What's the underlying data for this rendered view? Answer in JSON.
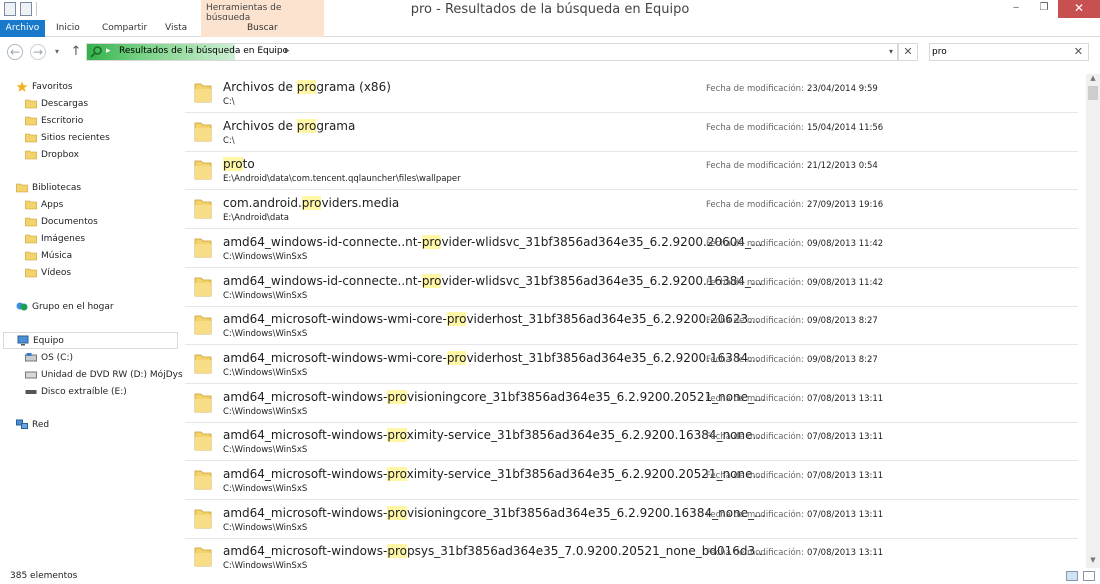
{
  "window": {
    "title": "pro - Resultados de la búsqueda en Equipo",
    "context_tab": "Herramientas de búsqueda",
    "buttons": {
      "minimize": "‒",
      "maximize": "❐",
      "close": "✕"
    }
  },
  "ribbon": {
    "tabs": [
      "Archivo",
      "Inicio",
      "Compartir",
      "Vista",
      "Buscar"
    ]
  },
  "address": {
    "breadcrumb": "Resultados de la búsqueda en Equipo",
    "search_value": "pro"
  },
  "nav": {
    "groups": [
      {
        "label": "Favoritos",
        "icon": "star-icon",
        "items": [
          {
            "label": "Descargas",
            "icon": "downloads-icon"
          },
          {
            "label": "Escritorio",
            "icon": "desktop-icon"
          },
          {
            "label": "Sitios recientes",
            "icon": "recent-places-icon"
          },
          {
            "label": "Dropbox",
            "icon": "dropbox-icon"
          }
        ]
      },
      {
        "label": "Bibliotecas",
        "icon": "libraries-icon",
        "items": [
          {
            "label": "Apps",
            "icon": "folder-icon"
          },
          {
            "label": "Documentos",
            "icon": "documents-icon"
          },
          {
            "label": "Imágenes",
            "icon": "pictures-icon"
          },
          {
            "label": "Música",
            "icon": "music-icon"
          },
          {
            "label": "Vídeos",
            "icon": "videos-icon"
          }
        ]
      },
      {
        "label": "Grupo en el hogar",
        "icon": "homegroup-icon",
        "items": []
      },
      {
        "label": "Equipo",
        "icon": "computer-icon",
        "selected": true,
        "items": [
          {
            "label": "OS (C:)",
            "icon": "drive-icon"
          },
          {
            "label": "Unidad de DVD RW (D:) MójDys",
            "icon": "dvd-drive-icon"
          },
          {
            "label": "Disco extraíble (E:)",
            "icon": "removable-drive-icon"
          }
        ]
      },
      {
        "label": "Red",
        "icon": "network-icon",
        "items": []
      }
    ]
  },
  "results": {
    "modified_label": "Fecha de modificación:",
    "items": [
      {
        "pre": "Archivos de ",
        "match": "pro",
        "post": "grama (x86)",
        "path": "C:\\",
        "date": "23/04/2014 9:59"
      },
      {
        "pre": "Archivos de ",
        "match": "pro",
        "post": "grama",
        "path": "C:\\",
        "date": "15/04/2014 11:56"
      },
      {
        "pre": "",
        "match": "pro",
        "post": "to",
        "path": "E:\\Android\\data\\com.tencent.qqlauncher\\files\\wallpaper",
        "date": "21/12/2013 0:54"
      },
      {
        "pre": "com.android.",
        "match": "pro",
        "post": "viders.media",
        "path": "E:\\Android\\data",
        "date": "27/09/2013 19:16"
      },
      {
        "pre": "amd64_windows-id-connecte..nt-",
        "match": "pro",
        "post": "vider-wlidsvc_31bf3856ad364e35_6.2.9200.20604_...",
        "path": "C:\\Windows\\WinSxS",
        "date": "09/08/2013 11:42"
      },
      {
        "pre": "amd64_windows-id-connecte..nt-",
        "match": "pro",
        "post": "vider-wlidsvc_31bf3856ad364e35_6.2.9200.16384_...",
        "path": "C:\\Windows\\WinSxS",
        "date": "09/08/2013 11:42"
      },
      {
        "pre": "amd64_microsoft-windows-wmi-core-",
        "match": "pro",
        "post": "viderhost_31bf3856ad364e35_6.2.9200.20623...",
        "path": "C:\\Windows\\WinSxS",
        "date": "09/08/2013 8:27"
      },
      {
        "pre": "amd64_microsoft-windows-wmi-core-",
        "match": "pro",
        "post": "viderhost_31bf3856ad364e35_6.2.9200.16384...",
        "path": "C:\\Windows\\WinSxS",
        "date": "09/08/2013 8:27"
      },
      {
        "pre": "amd64_microsoft-windows-",
        "match": "pro",
        "post": "visioningcore_31bf3856ad364e35_6.2.9200.20521_none_...",
        "path": "C:\\Windows\\WinSxS",
        "date": "07/08/2013 13:11"
      },
      {
        "pre": "amd64_microsoft-windows-",
        "match": "pro",
        "post": "ximity-service_31bf3856ad364e35_6.2.9200.16384_none...",
        "path": "C:\\Windows\\WinSxS",
        "date": "07/08/2013 13:11"
      },
      {
        "pre": "amd64_microsoft-windows-",
        "match": "pro",
        "post": "ximity-service_31bf3856ad364e35_6.2.9200.20521_none...",
        "path": "C:\\Windows\\WinSxS",
        "date": "07/08/2013 13:11"
      },
      {
        "pre": "amd64_microsoft-windows-",
        "match": "pro",
        "post": "visioningcore_31bf3856ad364e35_6.2.9200.16384_none_...",
        "path": "C:\\Windows\\WinSxS",
        "date": "07/08/2013 13:11"
      },
      {
        "pre": "amd64_microsoft-windows-",
        "match": "pro",
        "post": "psys_31bf3856ad364e35_7.0.9200.20521_none_bd016d3...",
        "path": "C:\\Windows\\WinSxS",
        "date": "07/08/2013 13:11"
      }
    ]
  },
  "status": {
    "count": "385 elementos"
  },
  "colors": {
    "accent": "#1979ca",
    "context_tab": "#fbe3d0",
    "match_highlight": "#fff7a6",
    "folder": "#f3d36b"
  }
}
